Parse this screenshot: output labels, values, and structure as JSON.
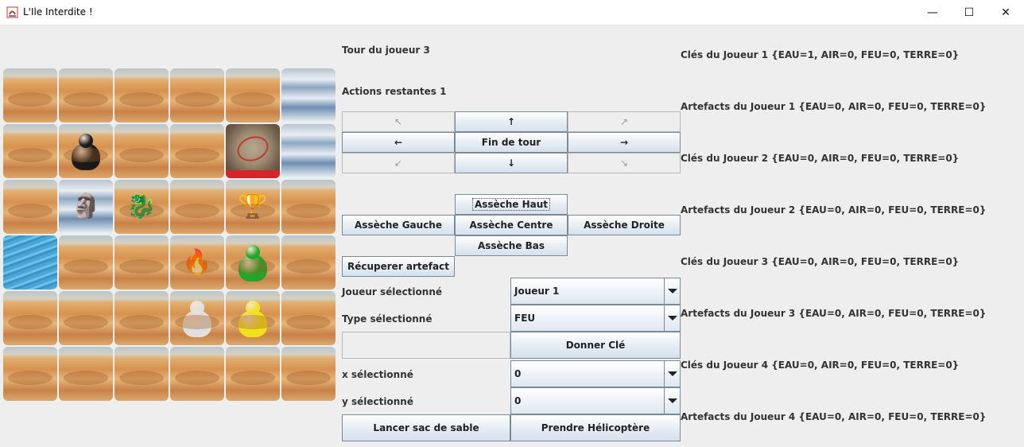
{
  "window": {
    "title": "L'Ile Interdite !",
    "minimize_glyph": "—",
    "maximize_glyph": "☐",
    "close_glyph": "✕"
  },
  "status": {
    "turn": "Tour du joueur 3",
    "actions": "Actions restantes 1"
  },
  "board": {
    "rows": [
      [
        "desert",
        "desert",
        "desert",
        "desert",
        "desert",
        "flood"
      ],
      [
        "desert",
        "desert",
        "desert",
        "desert",
        "heliport",
        "flood"
      ],
      [
        "desert",
        "flood",
        "desert",
        "desert",
        "desert",
        "desert"
      ],
      [
        "sea",
        "desert",
        "desert",
        "desert",
        "desert",
        "desert"
      ],
      [
        "desert",
        "desert",
        "desert",
        "desert",
        "desert",
        "desert"
      ],
      [
        "desert",
        "desert",
        "desert",
        "desert",
        "desert",
        "desert"
      ]
    ],
    "pawns": [
      {
        "row": 1,
        "col": 1,
        "color": "#1a1a1a",
        "name": "black-pawn"
      },
      {
        "row": 3,
        "col": 4,
        "color": "#22a52a",
        "name": "green-pawn"
      },
      {
        "row": 4,
        "col": 3,
        "color": "#e0e0e0",
        "name": "white-pawn"
      },
      {
        "row": 4,
        "col": 4,
        "color": "#f2e21b",
        "name": "yellow-pawn"
      }
    ],
    "artifacts": [
      {
        "row": 2,
        "col": 1,
        "glyph": "🗿",
        "name": "air-artifact-statue-icon"
      },
      {
        "row": 2,
        "col": 2,
        "glyph": "🐉",
        "name": "earth-artifact-lion-icon"
      },
      {
        "row": 2,
        "col": 4,
        "glyph": "🏆",
        "name": "water-artifact-chalice-icon"
      },
      {
        "row": 3,
        "col": 3,
        "glyph": "🔥",
        "name": "fire-artifact-crystal-icon"
      }
    ]
  },
  "moves": {
    "up_left": "↖",
    "up": "↑",
    "up_right": "↗",
    "left": "←",
    "end_turn": "Fin de tour",
    "right": "→",
    "down_left": "↙",
    "down": "↓",
    "down_right": "↘"
  },
  "dry": {
    "up": "Assèche Haut",
    "left": "Assèche Gauche",
    "center": "Assèche Centre",
    "right": "Assèche Droite",
    "down": "Assèche Bas"
  },
  "recover": "Récuperer artefact",
  "selectors": {
    "player_label": "Joueur sélectionné",
    "player_value": "Joueur 1",
    "type_label": "Type sélectionné",
    "type_value": "FEU",
    "give_key": "Donner Clé",
    "x_label": "x sélectionné",
    "x_value": "0",
    "y_label": "y sélectionné",
    "y_value": "0"
  },
  "actions": {
    "sandbag": "Lancer sac de sable",
    "helicopter": "Prendre Hélicoptère"
  },
  "players": [
    {
      "keys": "Clés du Joueur 1 {EAU=1, AIR=0, FEU=0, TERRE=0}",
      "artifacts": "Artefacts du Joueur 1 {EAU=0, AIR=0, FEU=0, TERRE=0}"
    },
    {
      "keys": "Clés du Joueur 2 {EAU=0, AIR=0, FEU=0, TERRE=0}",
      "artifacts": "Artefacts du Joueur 2 {EAU=0, AIR=0, FEU=0, TERRE=0}"
    },
    {
      "keys": "Clés du Joueur 3 {EAU=0, AIR=0, FEU=0, TERRE=0}",
      "artifacts": "Artefacts du Joueur 3 {EAU=0, AIR=0, FEU=0, TERRE=0}"
    },
    {
      "keys": "Clés du Joueur 4 {EAU=0, AIR=0, FEU=0, TERRE=0}",
      "artifacts": "Artefacts du Joueur 4 {EAU=0, AIR=0, FEU=0, TERRE=0}"
    }
  ]
}
